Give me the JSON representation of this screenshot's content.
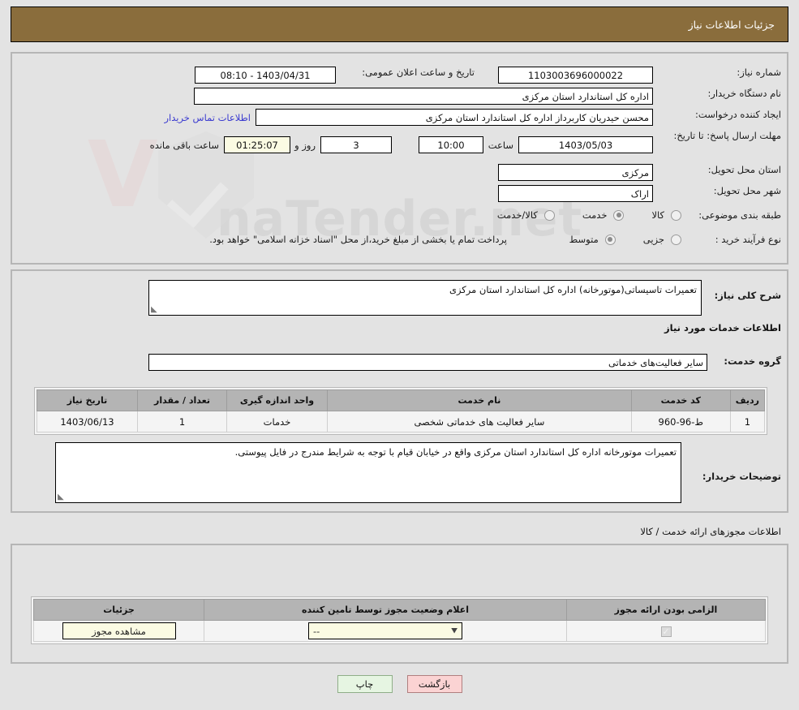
{
  "header": {
    "title": "جزئیات اطلاعات نیاز"
  },
  "top": {
    "need_number_label": "شماره نیاز:",
    "need_number_value": "1103003696000022",
    "announce_label": "تاریخ و ساعت اعلان عمومی:",
    "announce_value": "1403/04/31 - 08:10",
    "buyer_org_label": "نام دستگاه خریدار:",
    "buyer_org_value": "اداره کل استاندارد استان مرکزی",
    "creator_label": "ایجاد کننده درخواست:",
    "creator_value": "محسن حیدریان کاربرداز اداره کل استاندارد استان مرکزی",
    "contact_link": "اطلاعات تماس خریدار",
    "deadline_label": "مهلت ارسال پاسخ: تا تاریخ:",
    "deadline_date": "1403/05/03",
    "hour_label": "ساعت",
    "deadline_time": "10:00",
    "days_value": "3",
    "days_label": "روز و",
    "countdown_value": "01:25:07",
    "countdown_label": "ساعت باقی مانده",
    "province_label": "استان محل تحویل:",
    "province_value": "مرکزی",
    "city_label": "شهر محل تحویل:",
    "city_value": "اراک",
    "category_label": "طبقه بندی موضوعی:",
    "category_options": [
      {
        "label": "کالا",
        "selected": false
      },
      {
        "label": "خدمت",
        "selected": true
      },
      {
        "label": "کالا/خدمت",
        "selected": false
      }
    ],
    "process_label": "نوع فرآیند خرید :",
    "process_options": [
      {
        "label": "جزیی",
        "selected": false
      },
      {
        "label": "متوسط",
        "selected": true
      }
    ],
    "process_note": "پرداخت تمام یا بخشی از مبلغ خرید،از محل \"اسناد خزانه اسلامی\" خواهد بود."
  },
  "mid": {
    "general_desc_label": "شرح کلی نیاز:",
    "general_desc_value": "تعمیرات تاسیساتی(موتورخانه) اداره کل استاندارد استان مرکزی",
    "services_heading": "اطلاعات خدمات مورد نیاز",
    "service_group_label": "گروه خدمت:",
    "service_group_value": "سایر فعالیت‌های خدماتی",
    "service_table": {
      "columns": [
        "ردیف",
        "کد خدمت",
        "نام خدمت",
        "واحد اندازه گیری",
        "تعداد / مقدار",
        "تاریخ نیاز"
      ],
      "rows": [
        {
          "row": "1",
          "code": "ط-96-960",
          "name": "سایر فعالیت های خدماتی شخصی",
          "unit": "خدمات",
          "qty": "1",
          "date": "1403/06/13"
        }
      ]
    },
    "buyer_notes_label": "توضیحات خریدار:",
    "buyer_notes_value": "تعمیرات موتورخانه اداره کل استاندارد استان مرکزی واقع در خیابان قیام با توجه به شرایط مندرج در فایل پیوستی."
  },
  "bottom": {
    "section_title": "اطلاعات مجوزهای ارائه خدمت / کالا",
    "license_table": {
      "columns": [
        "الزامی بودن ارائه مجوز",
        "اعلام وضعیت مجوز توسط تامین کننده",
        "جزئیات"
      ],
      "rows": [
        {
          "required_checked": true,
          "status_value": "--",
          "details_button": "مشاهده مجوز"
        }
      ]
    }
  },
  "footer": {
    "print_label": "چاپ",
    "back_label": "بازگشت"
  },
  "watermark": {
    "text": "naTender.net"
  },
  "colors": {
    "header_brown": "#8a6d3c",
    "page_bg": "#e3e3e3",
    "link_blue": "#3b3bd0",
    "field_yellow": "#fbfbe3",
    "back_btn": "#fbd3d3",
    "print_btn": "#e6f5e2"
  }
}
